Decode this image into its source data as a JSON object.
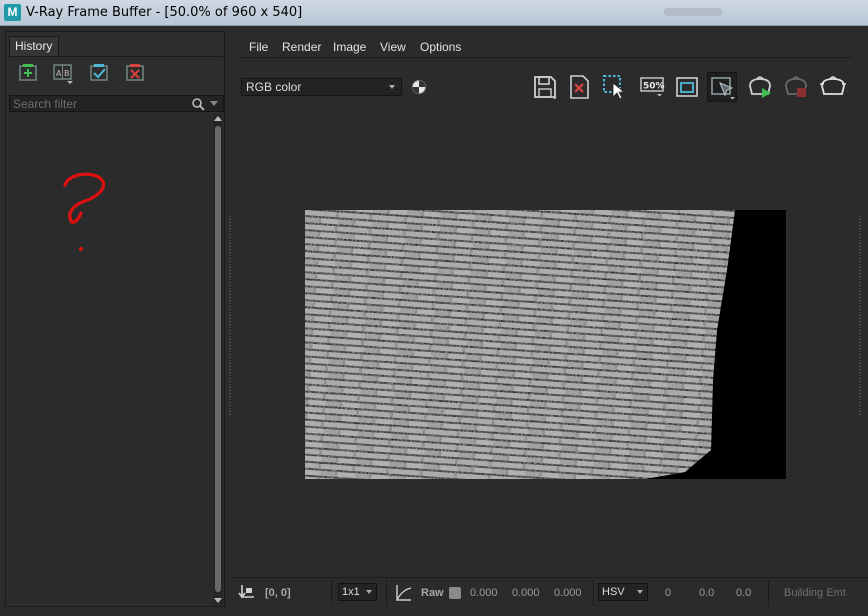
{
  "window": {
    "title": "V-Ray Frame Buffer - [50.0% of 960 x 540]",
    "app_icon": "M"
  },
  "history": {
    "tab_label": "History",
    "buttons": [
      {
        "name": "save-to-history",
        "icon": "add-icon"
      },
      {
        "name": "compare-ab",
        "icon": "ab-compare-icon"
      },
      {
        "name": "load-history",
        "icon": "check-icon"
      },
      {
        "name": "remove-history",
        "icon": "remove-icon"
      }
    ],
    "search_placeholder": "Search filter",
    "annotation_icon": "question-mark-drawing"
  },
  "menu": {
    "items": [
      "File",
      "Render",
      "Image",
      "View",
      "Options"
    ]
  },
  "toolbar": {
    "channel": "RGB color",
    "zoom_label": "50%",
    "buttons": [
      "save-image-icon",
      "clear-image-icon",
      "region-select-icon",
      "zoom-50-icon",
      "frame-icon",
      "track-mouse-icon",
      "render-interactive-icon",
      "stop-render-icon",
      "render-icon"
    ],
    "colors": {
      "accent_green": "#3fbf4f",
      "red": "#d94040",
      "cyan": "#4fb8d8"
    }
  },
  "status": {
    "coords": "[0, 0]",
    "sample_size": "1x1",
    "raw_label": "Raw",
    "raw_values": [
      "0.000",
      "0.000",
      "0.000"
    ],
    "color_model": "HSV",
    "hsv_values": [
      "0",
      "0.0",
      "0.0"
    ],
    "message": "Building Emt"
  }
}
